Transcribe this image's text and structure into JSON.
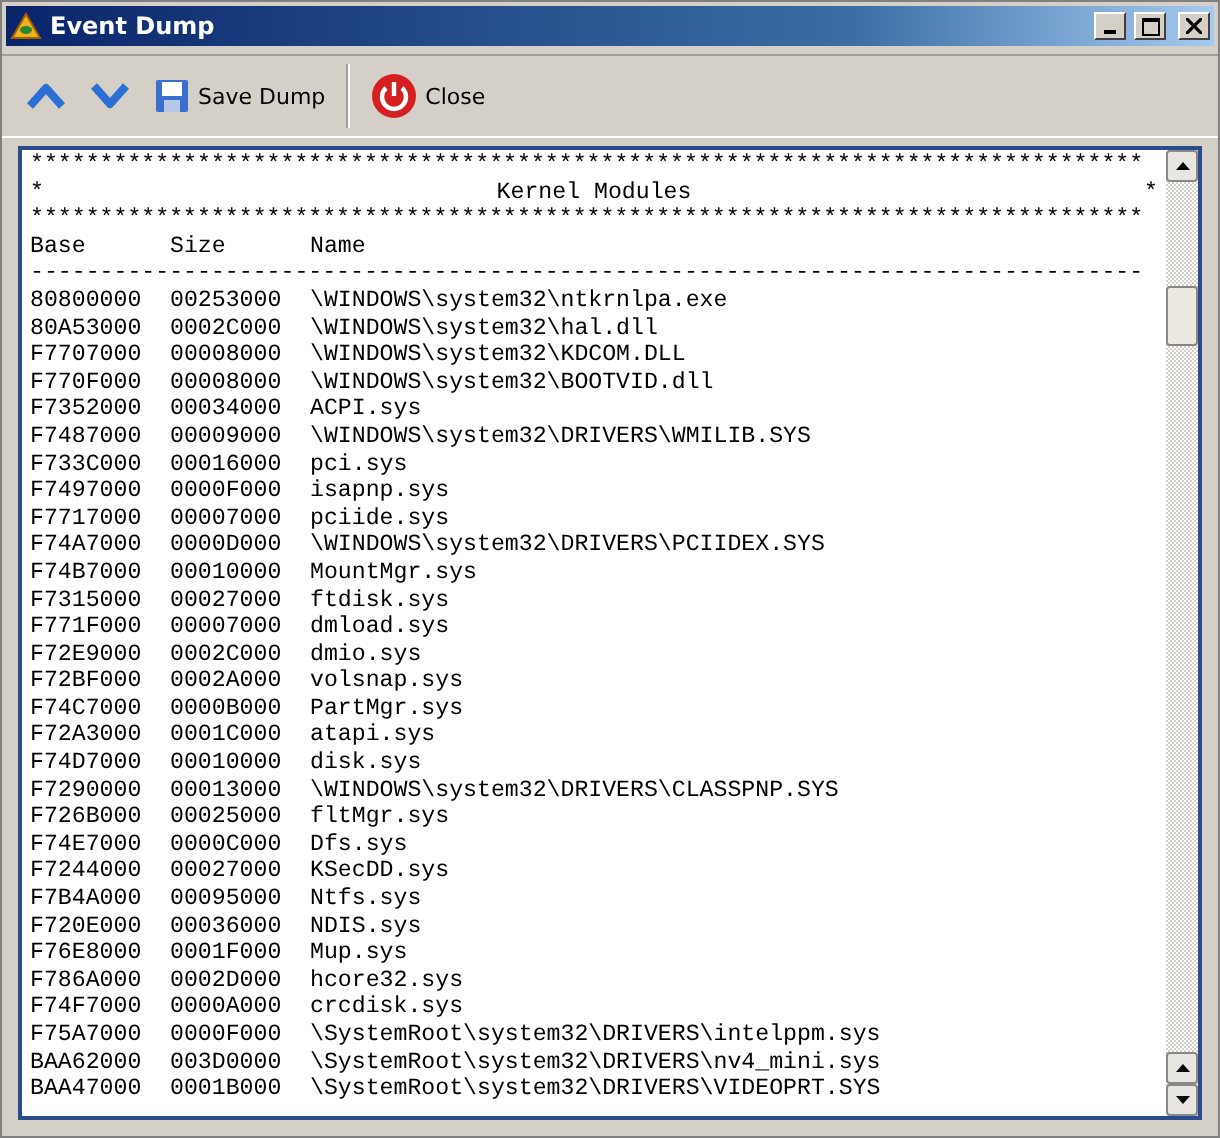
{
  "window": {
    "title": "Event Dump"
  },
  "toolbar": [
    {
      "kind": "up"
    },
    {
      "kind": "down"
    },
    {
      "kind": "save",
      "label": "Save Dump"
    },
    {
      "kind": "separator"
    },
    {
      "kind": "close",
      "label": "Close"
    }
  ],
  "listing": {
    "banner_top": "********************************************************************************",
    "banner_title": {
      "left": "*",
      "title": "Kernel Modules",
      "right": "*"
    },
    "banner_bottom": "********************************************************************************",
    "columns": [
      "Base",
      "Size",
      "Name"
    ],
    "divider": "--------------------------------------------------------------------------------",
    "rows": [
      [
        "80800000",
        "00253000",
        "\\WINDOWS\\system32\\ntkrnlpa.exe"
      ],
      [
        "80A53000",
        "0002C000",
        "\\WINDOWS\\system32\\hal.dll"
      ],
      [
        "F7707000",
        "00008000",
        "\\WINDOWS\\system32\\KDCOM.DLL"
      ],
      [
        "F770F000",
        "00008000",
        "\\WINDOWS\\system32\\BOOTVID.dll"
      ],
      [
        "F7352000",
        "00034000",
        "ACPI.sys"
      ],
      [
        "F7487000",
        "00009000",
        "\\WINDOWS\\system32\\DRIVERS\\WMILIB.SYS"
      ],
      [
        "F733C000",
        "00016000",
        "pci.sys"
      ],
      [
        "F7497000",
        "0000F000",
        "isapnp.sys"
      ],
      [
        "F7717000",
        "00007000",
        "pciide.sys"
      ],
      [
        "F74A7000",
        "0000D000",
        "\\WINDOWS\\system32\\DRIVERS\\PCIIDEX.SYS"
      ],
      [
        "F74B7000",
        "00010000",
        "MountMgr.sys"
      ],
      [
        "F7315000",
        "00027000",
        "ftdisk.sys"
      ],
      [
        "F771F000",
        "00007000",
        "dmload.sys"
      ],
      [
        "F72E9000",
        "0002C000",
        "dmio.sys"
      ],
      [
        "F72BF000",
        "0002A000",
        "volsnap.sys"
      ],
      [
        "F74C7000",
        "0000B000",
        "PartMgr.sys"
      ],
      [
        "F72A3000",
        "0001C000",
        "atapi.sys"
      ],
      [
        "F74D7000",
        "00010000",
        "disk.sys"
      ],
      [
        "F7290000",
        "00013000",
        "\\WINDOWS\\system32\\DRIVERS\\CLASSPNP.SYS"
      ],
      [
        "F726B000",
        "00025000",
        "fltMgr.sys"
      ],
      [
        "F74E7000",
        "0000C000",
        "Dfs.sys"
      ],
      [
        "F7244000",
        "00027000",
        "KSecDD.sys"
      ],
      [
        "F7B4A000",
        "00095000",
        "Ntfs.sys"
      ],
      [
        "F720E000",
        "00036000",
        "NDIS.sys"
      ],
      [
        "F76E8000",
        "0001F000",
        "Mup.sys"
      ],
      [
        "F786A000",
        "0002D000",
        "hcore32.sys"
      ],
      [
        "F74F7000",
        "0000A000",
        "crcdisk.sys"
      ],
      [
        "F75A7000",
        "0000F000",
        "\\SystemRoot\\system32\\DRIVERS\\intelppm.sys"
      ],
      [
        "BAA62000",
        "003D0000",
        "\\SystemRoot\\system32\\DRIVERS\\nv4_mini.sys"
      ],
      [
        "BAA47000",
        "0001B000",
        "\\SystemRoot\\system32\\DRIVERS\\VIDEOPRT.SYS"
      ]
    ]
  }
}
